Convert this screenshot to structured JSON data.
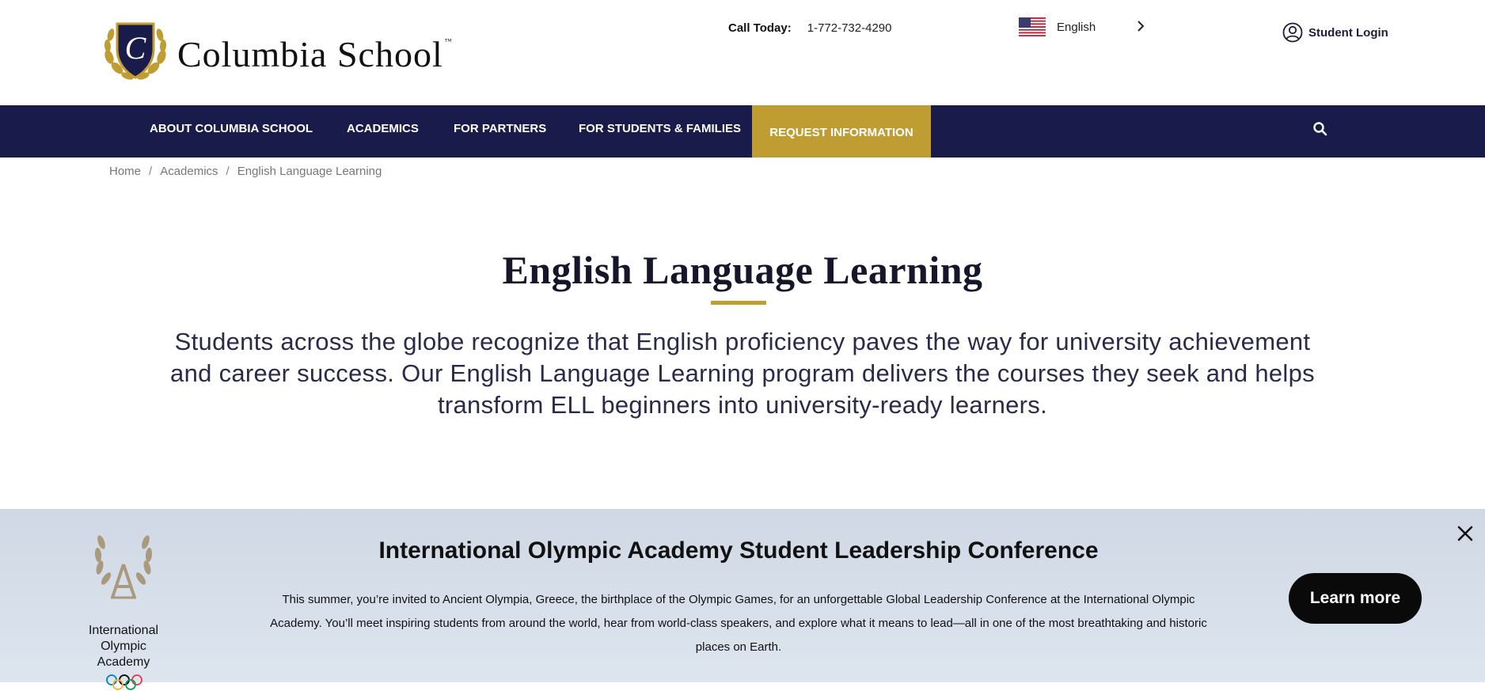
{
  "brand": {
    "name": "Columbia School",
    "tm": "™"
  },
  "header": {
    "call_label": "Call Today:",
    "phone": "1-772-732-4290",
    "language": "English",
    "login_label": "Student Login"
  },
  "nav": {
    "items": [
      {
        "label": "ABOUT COLUMBIA SCHOOL"
      },
      {
        "label": "ACADEMICS"
      },
      {
        "label": "FOR PARTNERS"
      },
      {
        "label": "FOR STUDENTS & FAMILIES"
      }
    ],
    "cta": "REQUEST INFORMATION"
  },
  "breadcrumb": {
    "items": [
      "Home",
      "Academics",
      "English Language Learning"
    ],
    "separator": "/"
  },
  "main": {
    "title": "English Language Learning",
    "intro": "Students across the globe recognize that English proficiency paves the way for university achievement and career success. Our English Language Learning program delivers the courses they seek and helps transform ELL beginners into university-ready learners."
  },
  "banner": {
    "logo_lines": [
      "International",
      "Olympic",
      "Academy"
    ],
    "title": "International Olympic Academy Student Leadership Conference",
    "body": "This summer, you’re invited to Ancient Olympia, Greece, the birthplace of the Olympic Games, for an unforgettable Global Leadership Conference at the International Olympic Academy. You’ll meet inspiring students from around the world, hear from world-class speakers, and explore what it means to lead—all in one of the most breathtaking and historic places on Earth.",
    "button": "Learn more"
  },
  "colors": {
    "navy": "#191b4a",
    "gold": "#c09d33",
    "banner_bg": "#d6dee9"
  },
  "icons": [
    "crest-icon",
    "us-flag-icon",
    "chevron-right-icon",
    "user-circle-icon",
    "search-icon",
    "laurel-icon",
    "olympic-rings-icon",
    "close-icon"
  ]
}
